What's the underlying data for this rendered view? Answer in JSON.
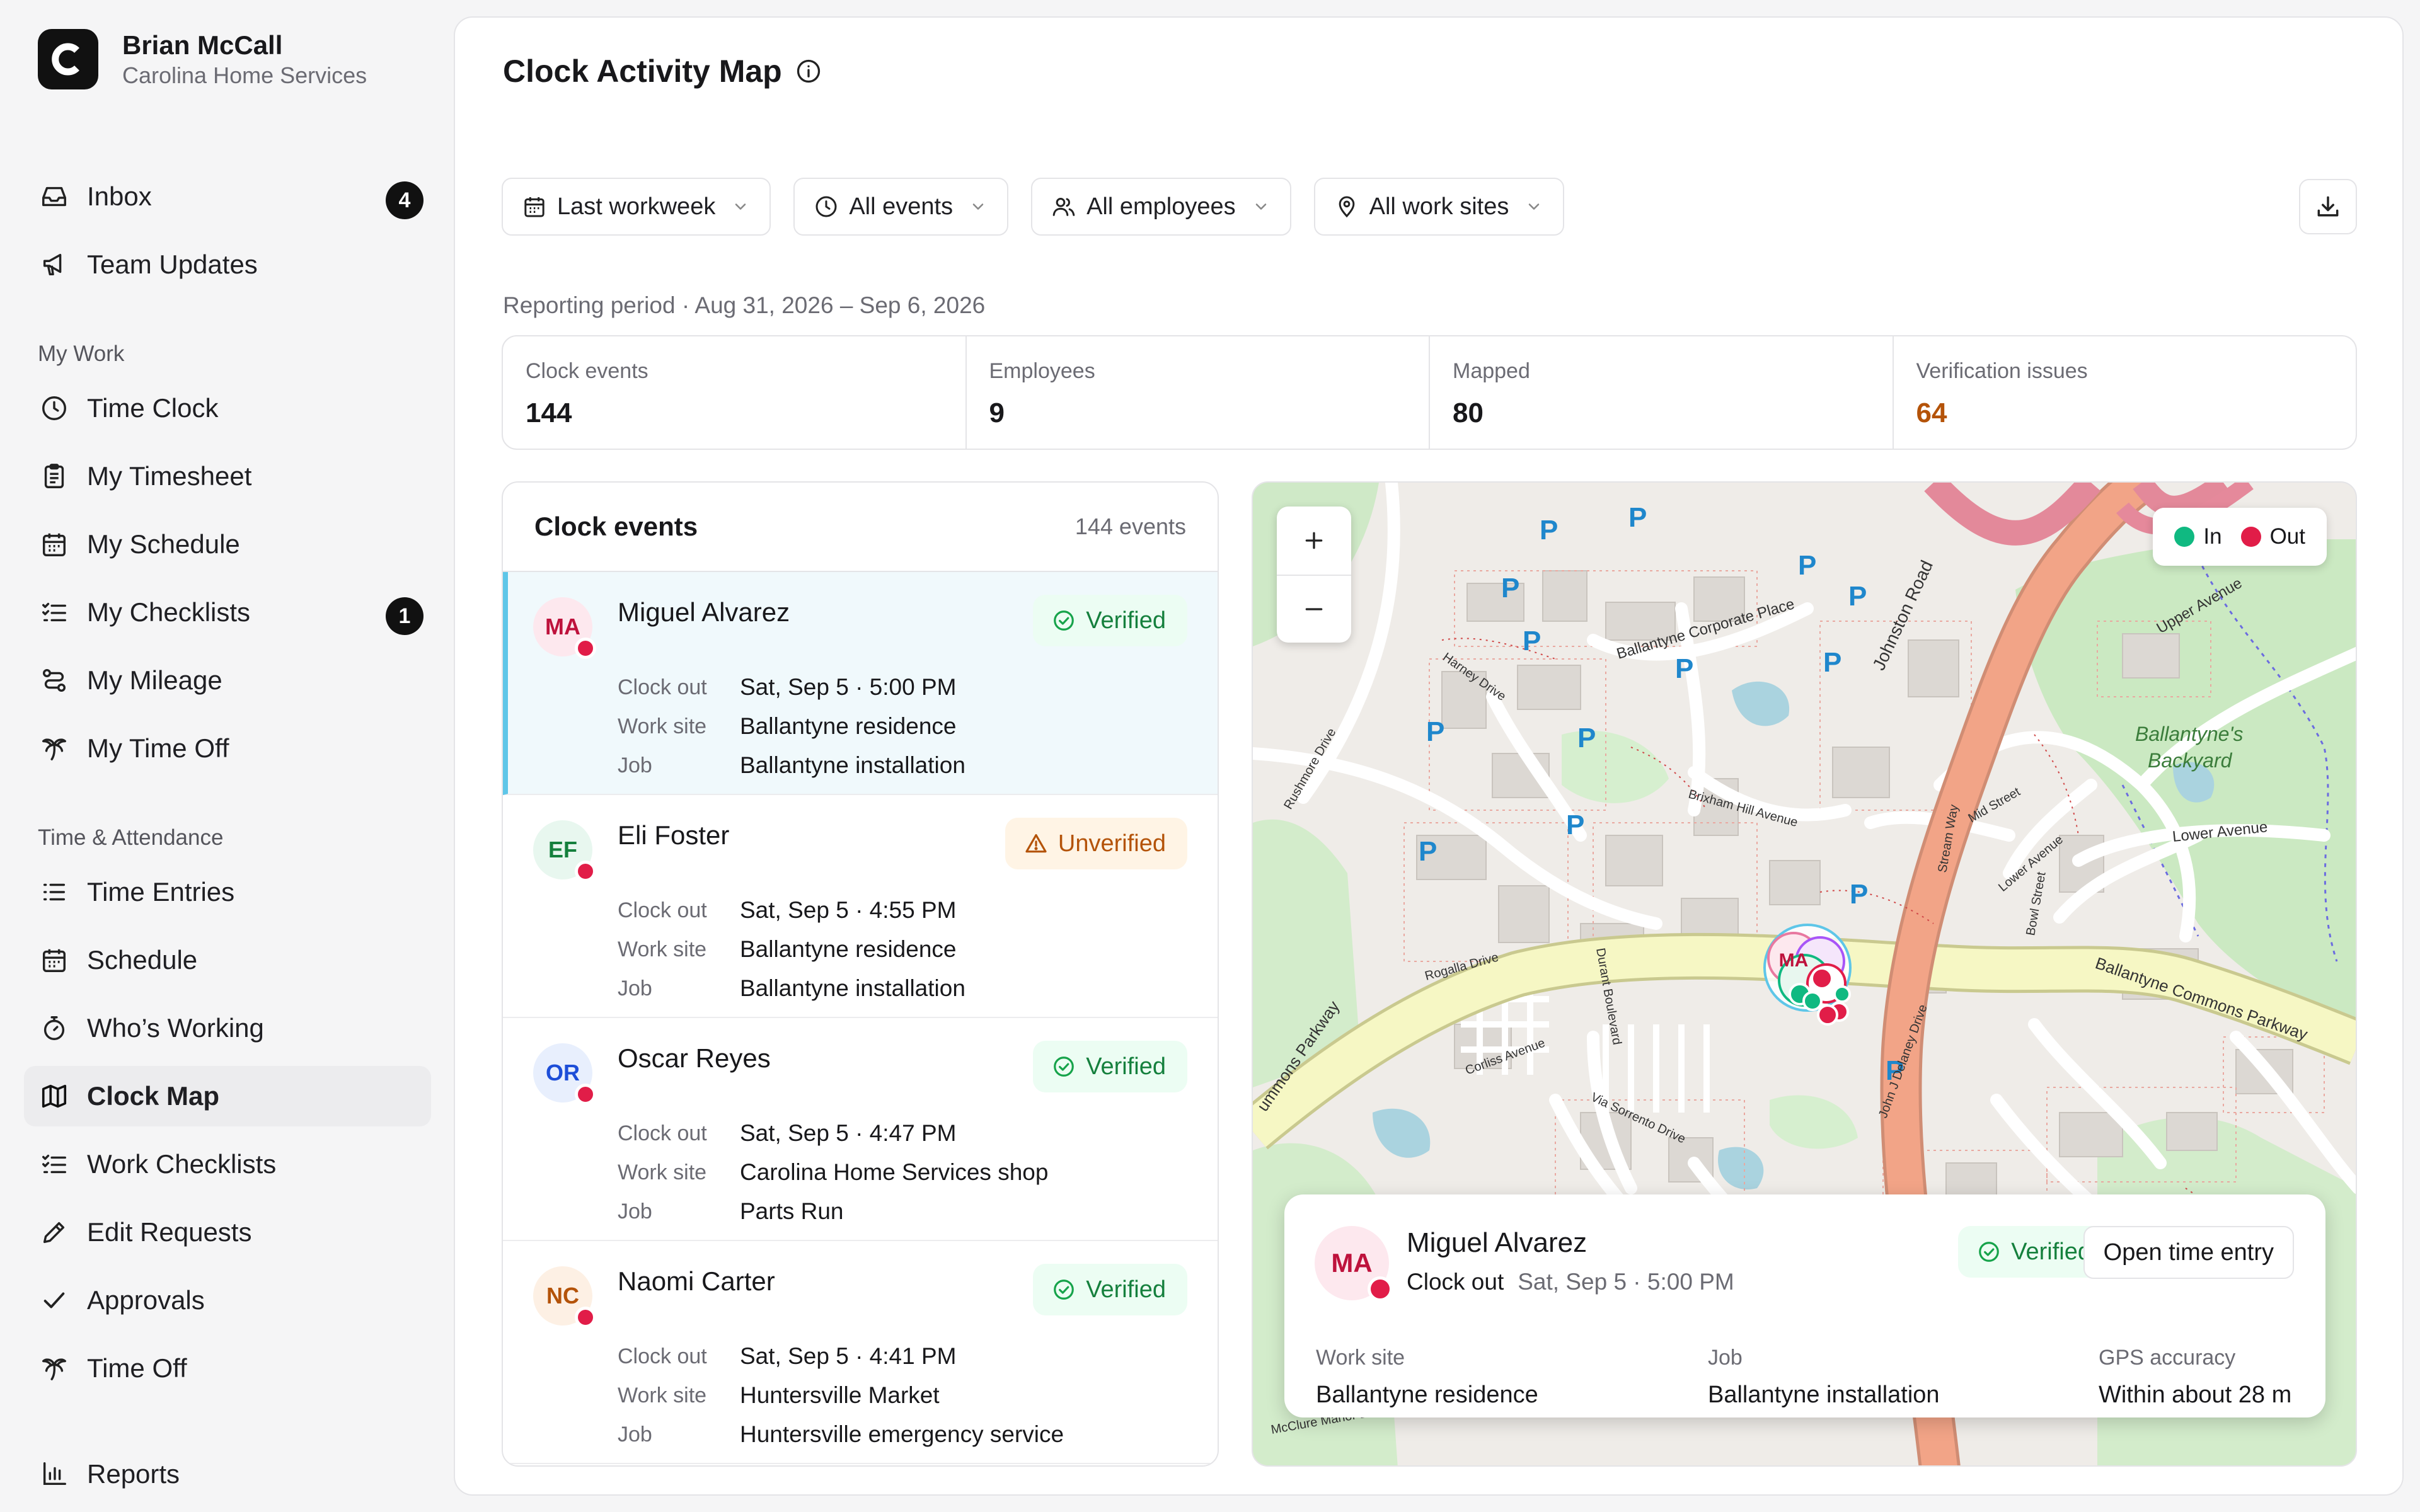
{
  "sidebar": {
    "brand_name": "Brian McCall",
    "brand_sub": "Carolina Home Services",
    "inbox": "Inbox",
    "inbox_badge": "4",
    "team_updates": "Team Updates",
    "section_my_work": "My Work",
    "time_clock": "Time Clock",
    "my_timesheet": "My Timesheet",
    "my_schedule": "My Schedule",
    "my_checklists": "My Checklists",
    "my_checklists_badge": "1",
    "my_mileage": "My Mileage",
    "my_time_off": "My Time Off",
    "section_attendance": "Time & Attendance",
    "time_entries": "Time Entries",
    "schedule": "Schedule",
    "whos_working": "Who’s Working",
    "clock_map": "Clock Map",
    "work_checklists": "Work Checklists",
    "edit_requests": "Edit Requests",
    "approvals": "Approvals",
    "time_off": "Time Off",
    "reports": "Reports"
  },
  "page": {
    "title": "Clock Activity Map",
    "filters": {
      "period": "Last workweek",
      "events": "All events",
      "employees": "All employees",
      "sites": "All work sites"
    },
    "period_text": "Reporting period · Aug 31, 2026 – Sep 6, 2026"
  },
  "stats": [
    {
      "label": "Clock events",
      "value": "144"
    },
    {
      "label": "Employees",
      "value": "9"
    },
    {
      "label": "Mapped",
      "value": "80"
    },
    {
      "label": "Verification issues",
      "value": "64"
    }
  ],
  "events": {
    "title": "Clock events",
    "count": "144 events",
    "key_work_site": "Work site",
    "key_job": "Job",
    "items": [
      {
        "initials": "MA",
        "name": "Miguel Alvarez",
        "status": "Verified",
        "type": "Clock out",
        "time": "Sat, Sep 5 · 5:00 PM",
        "site": "Ballantyne residence",
        "job": "Ballantyne installation"
      },
      {
        "initials": "EF",
        "name": "Eli Foster",
        "status": "Unverified",
        "type": "Clock out",
        "time": "Sat, Sep 5 · 4:55 PM",
        "site": "Ballantyne residence",
        "job": "Ballantyne installation"
      },
      {
        "initials": "OR",
        "name": "Oscar Reyes",
        "status": "Verified",
        "type": "Clock out",
        "time": "Sat, Sep 5 · 4:47 PM",
        "site": "Carolina Home Services shop",
        "job": "Parts Run"
      },
      {
        "initials": "NC",
        "name": "Naomi Carter",
        "status": "Verified",
        "type": "Clock out",
        "time": "Sat, Sep 5 · 4:41 PM",
        "site": "Huntersville Market",
        "job": "Huntersville emergency service"
      }
    ]
  },
  "map": {
    "legend_in": "In",
    "legend_out": "Out",
    "color_in": "#10b981",
    "color_out": "#e11d48",
    "labels": {
      "johnston": "Johnston Road",
      "corporate": "Ballantyne Corporate Place",
      "upper": "Upper Avenue",
      "backyard1": "Ballantyne's",
      "backyard2": "Backyard",
      "lower": "Lower Avenue",
      "commons": "Ballantyne Commons Parkway",
      "commons_w": "ummons Parkway",
      "harney": "Harney Drive",
      "rushmore": "Rushmore Drive",
      "brixham": "Brixham Hill Avenue",
      "mid": "Mid Street",
      "stream": "Stream Way",
      "lower_av": "Lower Avenue",
      "bowl": "Bowl Street",
      "rogalla": "Rogalla Drive",
      "corliss": "Corliss Avenue",
      "durant": "Durant Boulevard",
      "sorrento": "Via Sorrento Drive",
      "delaney": "John J Delaney Drive",
      "mcclure": "McClure Manor Dr",
      "cluster_label": "MA",
      "park_glyph": "P"
    },
    "popup": {
      "initials": "MA",
      "name": "Miguel Alvarez",
      "type": "Clock out",
      "time": "Sat, Sep 5 · 5:00 PM",
      "status": "Verified",
      "open_label": "Open time entry",
      "work_site_key": "Work site",
      "work_site": "Ballantyne residence",
      "job_key": "Job",
      "job": "Ballantyne installation",
      "gps_key": "GPS accuracy",
      "gps": "Within about 28 m"
    }
  }
}
